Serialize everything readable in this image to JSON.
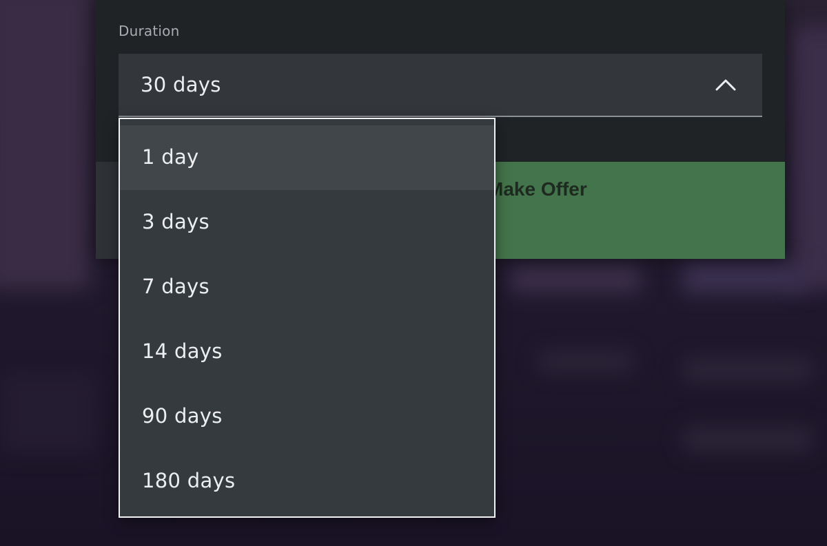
{
  "form": {
    "duration_label": "Duration",
    "selected_value": "30 days"
  },
  "footer": {
    "offer_button_label": "Make Offer"
  },
  "dropdown": {
    "options": [
      {
        "label": "1 day",
        "highlighted": true
      },
      {
        "label": "3 days",
        "highlighted": false
      },
      {
        "label": "7 days",
        "highlighted": false
      },
      {
        "label": "14 days",
        "highlighted": false
      },
      {
        "label": "90 days",
        "highlighted": false
      },
      {
        "label": "180 days",
        "highlighted": false
      }
    ]
  },
  "icons": {
    "select_chevron": "chevron-up-icon"
  },
  "colors": {
    "accent_green": "#44744b",
    "panel": "#202326",
    "field": "#33373b",
    "dropdown_bg": "#353a3e",
    "dropdown_highlight": "#41464a"
  }
}
